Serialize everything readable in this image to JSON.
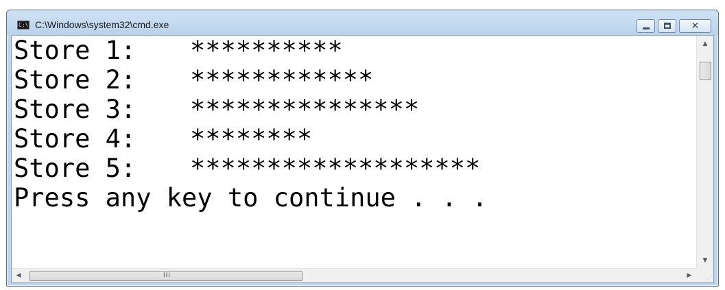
{
  "window": {
    "title": "C:\\Windows\\system32\\cmd.exe",
    "icon": "cmd-icon",
    "icon_text": "C:\\"
  },
  "caption": {
    "minimize": "minimize-icon",
    "maximize": "maximize-icon",
    "close": "close-icon",
    "close_glyph": "✕"
  },
  "console": {
    "lines": [
      {
        "label": "Store 1:",
        "stars": "**********"
      },
      {
        "label": "Store 2:",
        "stars": "************"
      },
      {
        "label": "Store 3:",
        "stars": "***************"
      },
      {
        "label": "Store 4:",
        "stars": "********"
      },
      {
        "label": "Store 5:",
        "stars": "*******************"
      }
    ],
    "prompt": "Press any key to continue . . ."
  },
  "scrollbars": {
    "up_arrow": "▲",
    "down_arrow": "▼",
    "left_arrow": "◀",
    "right_arrow": "▶",
    "h_grip": "III",
    "size_grip": "⋰"
  },
  "colors": {
    "console_bg": "#ffffff",
    "console_fg": "#000000",
    "frame": "#bcd6ee"
  }
}
